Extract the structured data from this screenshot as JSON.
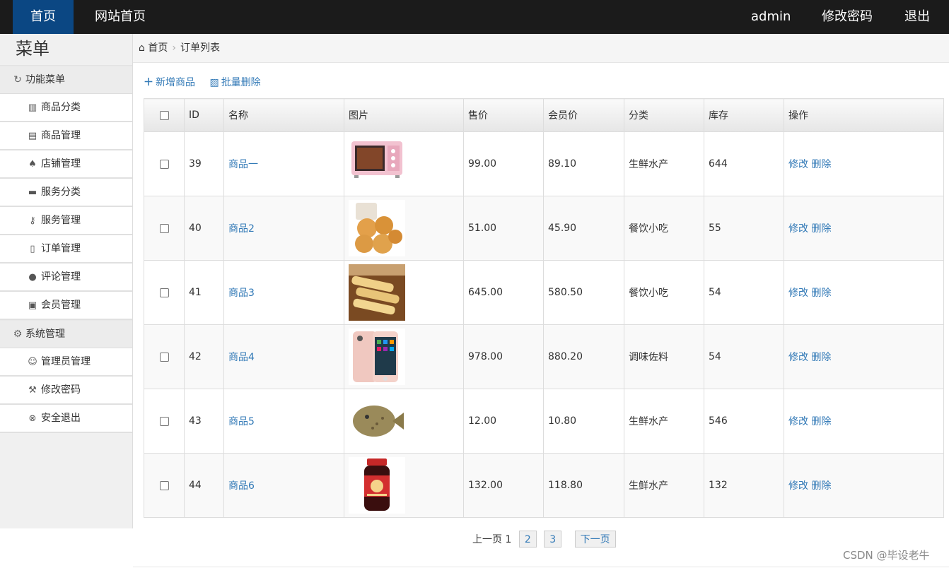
{
  "topbar": {
    "home": "首页",
    "site_home": "网站首页",
    "user": "admin",
    "change_password": "修改密码",
    "logout": "退出"
  },
  "sidebar": {
    "title": "菜单",
    "group1": {
      "label": "功能菜单",
      "icon": "refresh-icon"
    },
    "items1": [
      {
        "label": "商品分类",
        "icon": "books-icon"
      },
      {
        "label": "商品管理",
        "icon": "list-icon"
      },
      {
        "label": "店铺管理",
        "icon": "spade-icon"
      },
      {
        "label": "服务分类",
        "icon": "folder-icon"
      },
      {
        "label": "服务管理",
        "icon": "key-icon"
      },
      {
        "label": "订单管理",
        "icon": "file-icon"
      },
      {
        "label": "评论管理",
        "icon": "comment-icon"
      },
      {
        "label": "会员管理",
        "icon": "vcard-icon"
      }
    ],
    "group2": {
      "label": "系统管理",
      "icon": "gear-icon"
    },
    "items2": [
      {
        "label": "管理员管理",
        "icon": "smile-icon"
      },
      {
        "label": "修改密码",
        "icon": "wrench-icon"
      },
      {
        "label": "安全退出",
        "icon": "close-circle-icon"
      }
    ]
  },
  "breadcrumb": {
    "home": "首页",
    "current": "订单列表",
    "icon": "home-icon"
  },
  "toolbar": {
    "add": "新增商品",
    "batch_delete": "批量删除",
    "add_icon": "plus-icon",
    "delete_icon": "trash-icon"
  },
  "table": {
    "headers": [
      "ID",
      "名称",
      "图片",
      "售价",
      "会员价",
      "分类",
      "库存",
      "操作"
    ],
    "edit_label": "修改",
    "delete_label": "删除",
    "rows": [
      {
        "id": "39",
        "name": "商品一",
        "image": "oven",
        "price": "99.00",
        "member_price": "89.10",
        "category": "生鲜水产",
        "stock": "644"
      },
      {
        "id": "40",
        "name": "商品2",
        "image": "pastry",
        "price": "51.00",
        "member_price": "45.90",
        "category": "餐饮小吃",
        "stock": "55"
      },
      {
        "id": "41",
        "name": "商品3",
        "image": "rolls",
        "price": "645.00",
        "member_price": "580.50",
        "category": "餐饮小吃",
        "stock": "54"
      },
      {
        "id": "42",
        "name": "商品4",
        "image": "phone",
        "price": "978.00",
        "member_price": "880.20",
        "category": "调味佐料",
        "stock": "54"
      },
      {
        "id": "43",
        "name": "商品5",
        "image": "fish",
        "price": "12.00",
        "member_price": "10.80",
        "category": "生鲜水产",
        "stock": "546"
      },
      {
        "id": "44",
        "name": "商品6",
        "image": "jar",
        "price": "132.00",
        "member_price": "118.80",
        "category": "生鲜水产",
        "stock": "132"
      }
    ]
  },
  "pager": {
    "prev": "上一页",
    "current": "1",
    "pages": [
      "2",
      "3"
    ],
    "next": "下一页"
  },
  "watermark": "CSDN @毕设老牛",
  "colors": {
    "topbar": "#1b1b1b",
    "active": "#0b4783",
    "link": "#337ab7"
  }
}
